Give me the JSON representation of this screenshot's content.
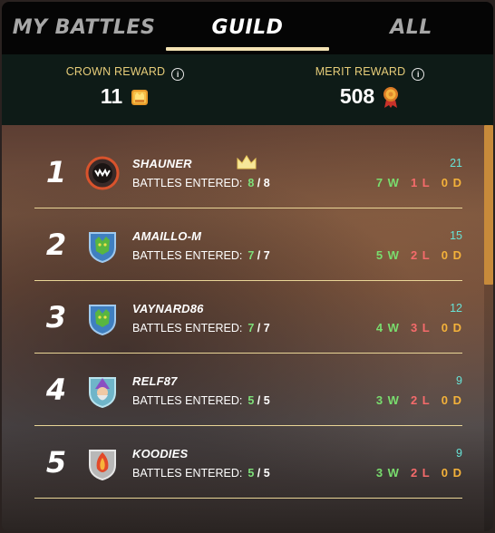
{
  "tabs": [
    {
      "label": "MY BATTLES",
      "active": false
    },
    {
      "label": "GUILD",
      "active": true
    },
    {
      "label": "ALL",
      "active": false
    }
  ],
  "rewards": {
    "crown": {
      "label": "CROWN REWARD",
      "value": "11",
      "icon": "crown-chest-icon"
    },
    "merit": {
      "label": "MERIT REWARD",
      "value": "508",
      "icon": "merit-medal-icon"
    }
  },
  "players": [
    {
      "rank": "1",
      "name": "SHAUNER",
      "battles_label": "BATTLES ENTERED:",
      "entered": "8",
      "total": "8",
      "score": "21",
      "wins": "7 W",
      "losses": "1 L",
      "draws": "0 D",
      "leader": true,
      "avatar": "dark-monster-avatar"
    },
    {
      "rank": "2",
      "name": "AMAILLO-M",
      "battles_label": "BATTLES ENTERED:",
      "entered": "7",
      "total": "7",
      "score": "15",
      "wins": "5 W",
      "losses": "2 L",
      "draws": "0 D",
      "leader": false,
      "avatar": "green-dragon-avatar"
    },
    {
      "rank": "3",
      "name": "VAYNARD86",
      "battles_label": "BATTLES ENTERED:",
      "entered": "7",
      "total": "7",
      "score": "12",
      "wins": "4 W",
      "losses": "3 L",
      "draws": "0 D",
      "leader": false,
      "avatar": "green-dragon-avatar"
    },
    {
      "rank": "4",
      "name": "RELF87",
      "battles_label": "BATTLES ENTERED:",
      "entered": "5",
      "total": "5",
      "score": "9",
      "wins": "3 W",
      "losses": "2 L",
      "draws": "0 D",
      "leader": false,
      "avatar": "wizard-avatar"
    },
    {
      "rank": "5",
      "name": "KOODIES",
      "battles_label": "BATTLES ENTERED:",
      "entered": "5",
      "total": "5",
      "score": "9",
      "wins": "3 W",
      "losses": "2 L",
      "draws": "0 D",
      "leader": false,
      "avatar": "fire-spirit-avatar"
    }
  ],
  "colors": {
    "accent_gold": "#e6cc79",
    "win": "#79dd6e",
    "loss": "#f56b6b",
    "draw": "#f4b23a",
    "score": "#67e3d7"
  }
}
